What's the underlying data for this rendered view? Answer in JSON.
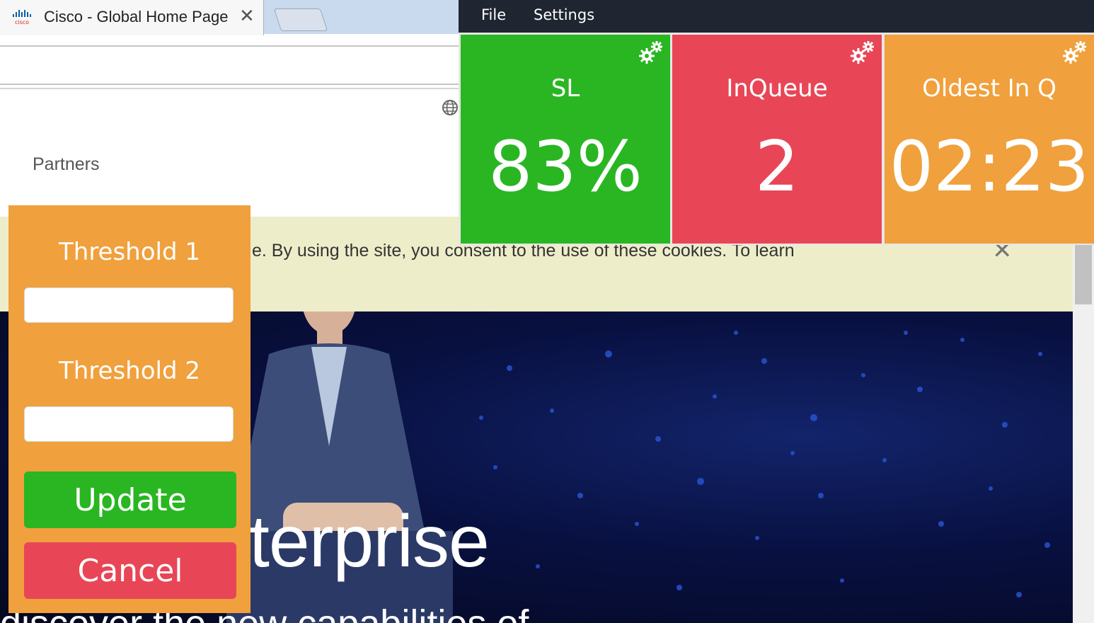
{
  "browser": {
    "tab_title": "Cisco - Global Home Page",
    "tab_close_glyph": "✕"
  },
  "website": {
    "nav_partners": "Partners",
    "cookie_text": "e. By using the site, you consent to the use of these cookies. To learn",
    "cookie_close_glyph": "✕",
    "hero_headline": "terprise",
    "hero_sub": "discover the new capabilities of"
  },
  "app": {
    "menu": {
      "file": "File",
      "settings": "Settings"
    },
    "tiles": [
      {
        "label": "SL",
        "value": "83%",
        "color": "#29b622",
        "icon": "gear-icon"
      },
      {
        "label": "InQueue",
        "value": "2",
        "color": "#e84656",
        "icon": "gear-icon"
      },
      {
        "label": "Oldest In Q",
        "value": "02:23",
        "color": "#f0a03c",
        "icon": "gear-icon"
      }
    ]
  },
  "threshold_panel": {
    "threshold1_label": "Threshold 1",
    "threshold1_value": "",
    "threshold2_label": "Threshold 2",
    "threshold2_value": "",
    "update_label": "Update",
    "cancel_label": "Cancel",
    "update_color": "#29b622",
    "cancel_color": "#e84656",
    "panel_color": "#f0a03c"
  }
}
